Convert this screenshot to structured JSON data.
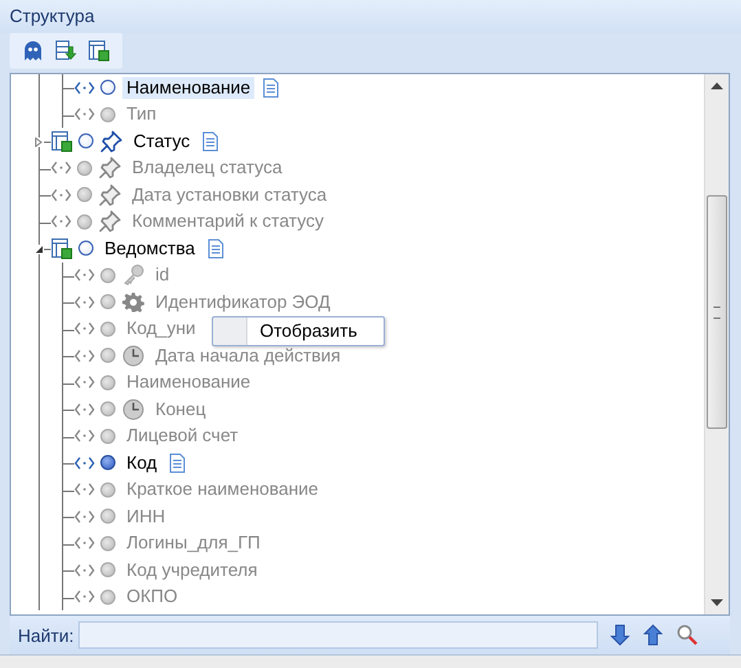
{
  "panel": {
    "title": "Структура"
  },
  "toolbar": [
    {
      "kind": "ghost"
    },
    {
      "kind": "import"
    },
    {
      "kind": "table"
    }
  ],
  "tree": [
    {
      "kind": "offscreen",
      "children": [
        {
          "kind": "field",
          "label": "Наименование",
          "active": true,
          "checked": false,
          "documented": true,
          "selected": true
        },
        {
          "kind": "field",
          "label": "Тип",
          "active": false,
          "checked": false,
          "documented": false,
          "selected": false
        }
      ]
    },
    {
      "kind": "status-table",
      "label": "Статус",
      "active": true,
      "checked": false,
      "documented": true,
      "selected": false,
      "expanded": false
    },
    {
      "kind": "status-field",
      "label": "Владелец статуса",
      "active": false,
      "checked": false,
      "documented": false,
      "selected": false
    },
    {
      "kind": "status-field",
      "label": "Дата установки статуса",
      "active": false,
      "checked": false,
      "documented": false,
      "selected": false
    },
    {
      "kind": "status-field",
      "label": "Комментарий к статусу",
      "active": false,
      "checked": false,
      "documented": false,
      "selected": false
    },
    {
      "kind": "table",
      "label": "Ведомства",
      "active": true,
      "checked": false,
      "documented": true,
      "selected": false,
      "expanded": true,
      "children": [
        {
          "kind": "key-field",
          "label": "id",
          "active": false,
          "checked": false,
          "documented": false,
          "selected": false
        },
        {
          "kind": "system-field",
          "label": "Идентификатор ЭОД",
          "active": false,
          "checked": false,
          "documented": false,
          "selected": false
        },
        {
          "kind": "field",
          "label": "Код_уни",
          "active": false,
          "checked": false,
          "documented": false,
          "selected": false
        },
        {
          "kind": "date-field",
          "label": "Дата начала действия",
          "active": false,
          "checked": false,
          "documented": false,
          "selected": false
        },
        {
          "kind": "field",
          "label": "Наименование",
          "active": false,
          "checked": false,
          "documented": false,
          "selected": false
        },
        {
          "kind": "date-field",
          "label": "Конец",
          "active": false,
          "checked": false,
          "documented": false,
          "selected": false
        },
        {
          "kind": "field",
          "label": "Лицевой счет",
          "active": false,
          "checked": false,
          "documented": false,
          "selected": false
        },
        {
          "kind": "field",
          "label": "Код",
          "active": true,
          "checked": true,
          "documented": true,
          "selected": false
        },
        {
          "kind": "field",
          "label": "Краткое наименование",
          "active": false,
          "checked": false,
          "documented": false,
          "selected": false
        },
        {
          "kind": "field",
          "label": "ИНН",
          "active": false,
          "checked": false,
          "documented": false,
          "selected": false
        },
        {
          "kind": "field",
          "label": "Логины_для_ГП",
          "active": false,
          "checked": false,
          "documented": false,
          "selected": false
        },
        {
          "kind": "field",
          "label": "Код учредителя",
          "active": false,
          "checked": false,
          "documented": false,
          "selected": false
        },
        {
          "kind": "field",
          "label": "ОКПО",
          "active": false,
          "checked": false,
          "documented": false,
          "selected": false
        }
      ]
    }
  ],
  "context_menu": {
    "items": [
      "Отобразить"
    ]
  },
  "search": {
    "label": "Найти:"
  }
}
